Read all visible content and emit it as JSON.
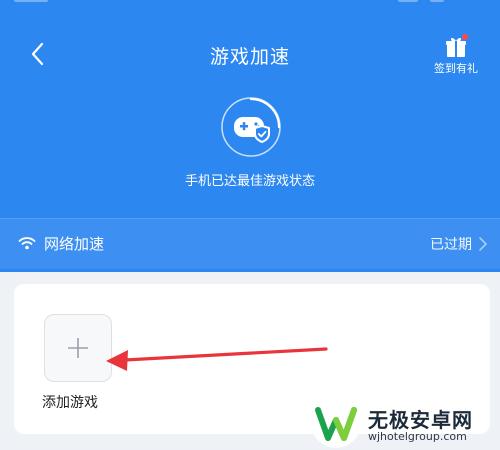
{
  "header": {
    "title": "游戏加速",
    "gift_label": "签到有礼"
  },
  "status": {
    "message": "手机已达最佳游戏状态"
  },
  "network": {
    "label": "网络加速",
    "state": "已过期"
  },
  "games": {
    "add_label": "添加游戏"
  },
  "watermark": {
    "name": "无极安卓网",
    "url": "wjhotelgroup.com"
  },
  "colors": {
    "header_blue": "#2d87f0",
    "arrow_red": "#e8343a",
    "badge_red": "#ff4a4a"
  }
}
